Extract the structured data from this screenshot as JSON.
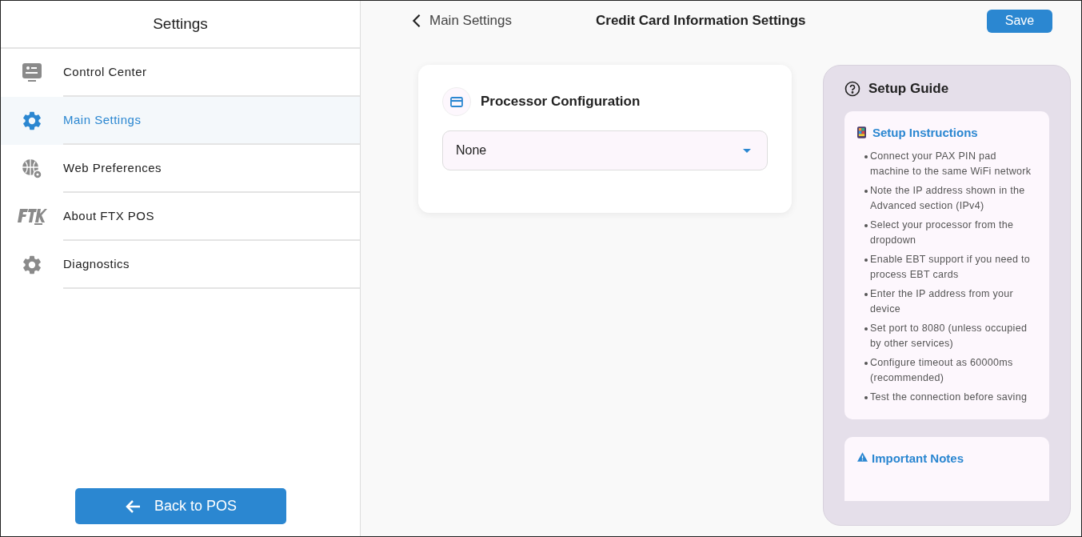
{
  "sidebar": {
    "title": "Settings",
    "items": [
      {
        "label": "Control Center",
        "selected": false
      },
      {
        "label": "Main Settings",
        "selected": true
      },
      {
        "label": "Web Preferences",
        "selected": false
      },
      {
        "label": "About FTX POS",
        "selected": false
      },
      {
        "label": "Diagnostics",
        "selected": false
      }
    ],
    "back_button": "Back to POS"
  },
  "header": {
    "back_link": "Main Settings",
    "title": "Credit Card Information Settings",
    "save_button": "Save"
  },
  "processor_card": {
    "title": "Processor Configuration",
    "select": {
      "value": "None"
    }
  },
  "setup_guide": {
    "title": "Setup Guide",
    "instructions": {
      "title": "Setup Instructions",
      "steps": [
        "Connect your PAX PIN pad machine to the same WiFi network",
        "Note the IP address shown in the Advanced section (IPv4)",
        "Select your processor from the dropdown",
        "Enable EBT support if you need to process EBT cards",
        "Enter the IP address from your device",
        "Set port to 8080 (unless occupied by other services)",
        "Configure timeout as 60000ms (recommended)",
        "Test the connection before saving"
      ]
    },
    "notes": {
      "title": "Important Notes"
    }
  }
}
